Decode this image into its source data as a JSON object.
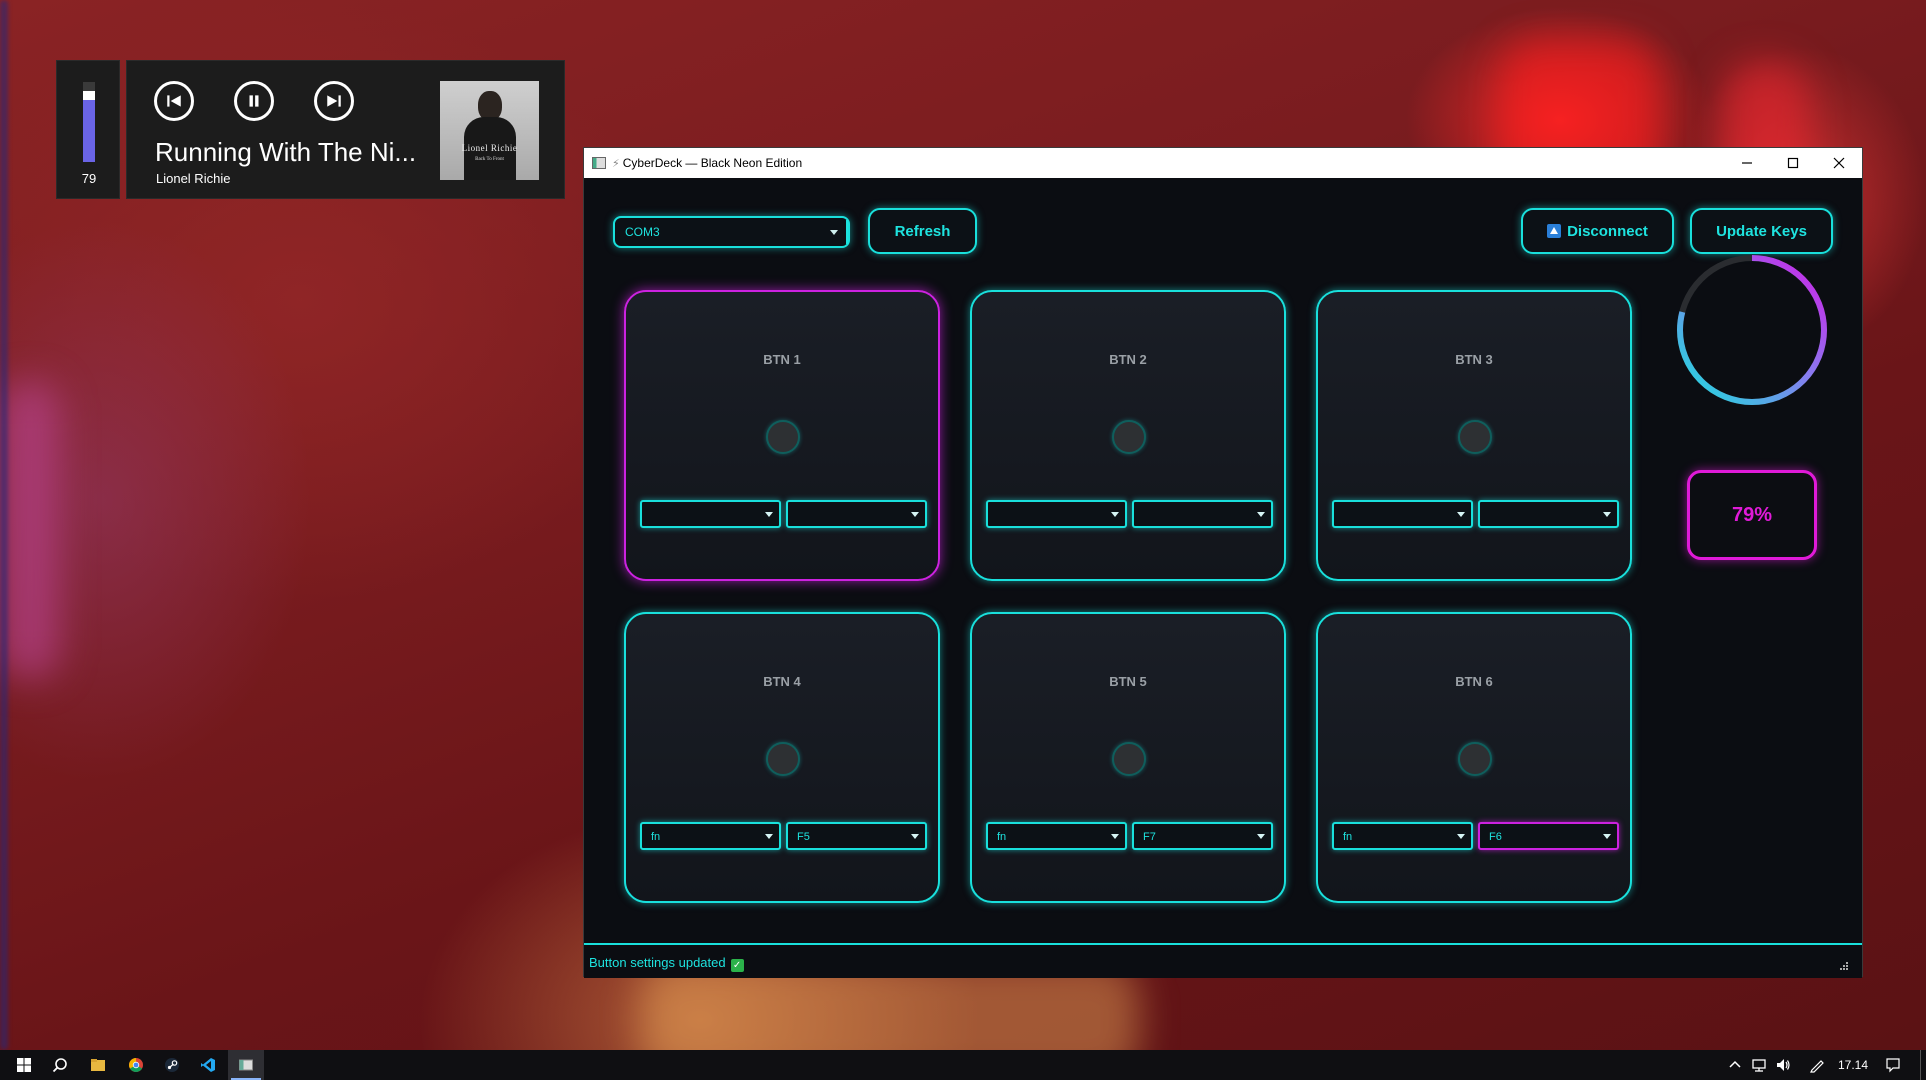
{
  "media": {
    "volume": 79,
    "volume_label": "79",
    "song_title": "Running With The Ni...",
    "artist": "Lionel Richie",
    "album_art_text": "Lionel Richie",
    "album_art_subtext": "Back To Front",
    "controls": [
      "previous-track",
      "pause",
      "next-track"
    ]
  },
  "window": {
    "title": "CyberDeck — Black Neon Edition",
    "port_select_value": "COM3",
    "refresh_label": "Refresh",
    "disconnect_label": "Disconnect",
    "update_keys_label": "Update Keys",
    "status_text": "Button settings updated",
    "buttons": [
      {
        "label": "BTN 1",
        "key1": "",
        "key2": "",
        "active": true
      },
      {
        "label": "BTN 2",
        "key1": "",
        "key2": ""
      },
      {
        "label": "BTN 3",
        "key1": "",
        "key2": ""
      },
      {
        "label": "BTN 4",
        "key1": "fn",
        "key2": "F5"
      },
      {
        "label": "BTN 5",
        "key1": "fn",
        "key2": "F7"
      },
      {
        "label": "BTN 6",
        "key1": "fn",
        "key2": "F6",
        "key2_highlighted": true
      }
    ],
    "gauge_percent": 79,
    "percent_label": "79%"
  },
  "taskbar": {
    "time": "17.14",
    "apps": [
      "windows-start",
      "search",
      "file-explorer",
      "chrome",
      "steam",
      "vscode",
      "cyberdeck"
    ]
  },
  "colors": {
    "neon_cyan": "#19e0dc",
    "neon_magenta": "#cc22e0",
    "volume_fill": "#6a64e6",
    "window_bg": "#0b0d12"
  }
}
